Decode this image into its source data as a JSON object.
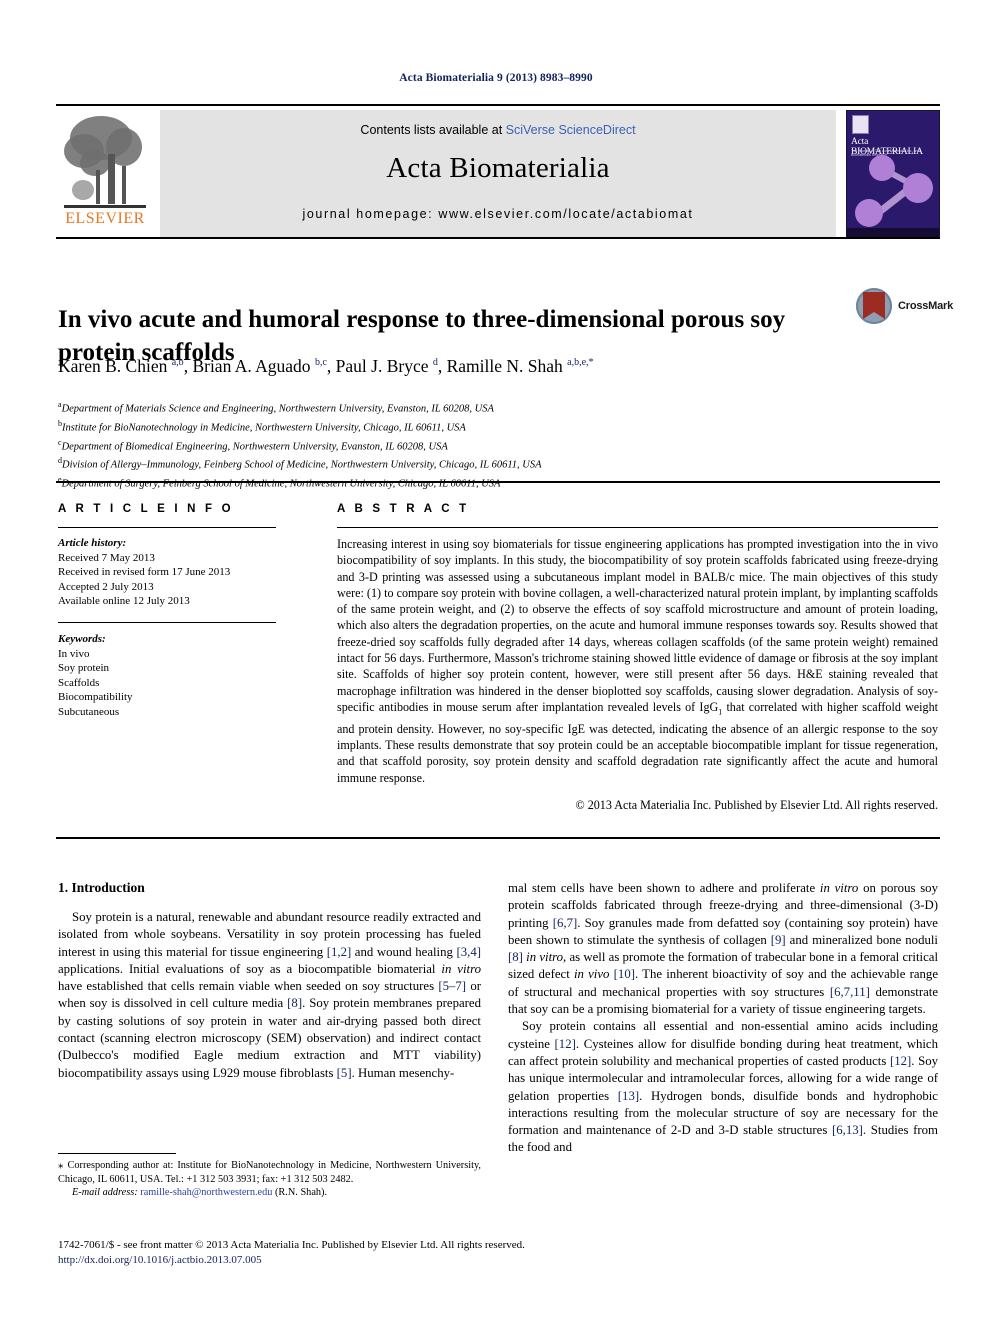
{
  "running_head": "Acta Biomaterialia 9 (2013) 8983–8990",
  "masthead": {
    "contents_prefix": "Contents lists available at ",
    "contents_link": "SciVerse ScienceDirect",
    "journal_name": "Acta Biomaterialia",
    "homepage": "journal homepage: www.elsevier.com/locate/actabiomat",
    "publisher_logo_text": "ELSEVIER",
    "cover_title": "Acta BIOMATERIALIA",
    "cover_subtitle": "The Journal of The Acta Materialia Inc. and Biomaterials Research"
  },
  "article": {
    "title": "In vivo acute and humoral response to three-dimensional porous soy protein scaffolds",
    "crossmark_label": "CrossMark",
    "authors_html": "Karen B. Chien <sup>a,b</sup>, Brian A. Aguado <sup>b,c</sup>, Paul J. Bryce <sup>d</sup>, Ramille N. Shah <sup>a,b,e,</sup><sup>*</sup>",
    "affiliations": [
      {
        "mark": "a",
        "text": "Department of Materials Science and Engineering, Northwestern University, Evanston, IL 60208, USA"
      },
      {
        "mark": "b",
        "text": "Institute for BioNanotechnology in Medicine, Northwestern University, Chicago, IL 60611, USA"
      },
      {
        "mark": "c",
        "text": "Department of Biomedical Engineering, Northwestern University, Evanston, IL 60208, USA"
      },
      {
        "mark": "d",
        "text": "Division of Allergy–Immunology, Feinberg School of Medicine, Northwestern University, Chicago, IL 60611, USA"
      },
      {
        "mark": "e",
        "text": "Department of Surgery, Feinberg School of Medicine, Northwestern University, Chicago, IL 60611, USA"
      }
    ]
  },
  "article_info": {
    "heading": "A R T I C L E   I N F O",
    "history_label": "Article history:",
    "history": [
      "Received 7 May 2013",
      "Received in revised form 17 June 2013",
      "Accepted 2 July 2013",
      "Available online 12 July 2013"
    ],
    "keywords_label": "Keywords:",
    "keywords": [
      "In vivo",
      "Soy protein",
      "Scaffolds",
      "Biocompatibility",
      "Subcutaneous"
    ]
  },
  "abstract": {
    "heading": "A B S T R A C T",
    "text_html": "Increasing interest in using soy biomaterials for tissue engineering applications has prompted investigation into the in vivo biocompatibility of soy implants. In this study, the biocompatibility of soy protein scaffolds fabricated using freeze-drying and 3-D printing was assessed using a subcutaneous implant model in BALB/c mice. The main objectives of this study were: (1) to compare soy protein with bovine collagen, a well-characterized natural protein implant, by implanting scaffolds of the same protein weight, and (2) to observe the effects of soy scaffold microstructure and amount of protein loading, which also alters the degradation properties, on the acute and humoral immune responses towards soy. Results showed that freeze-dried soy scaffolds fully degraded after 14 days, whereas collagen scaffolds (of the same protein weight) remained intact for 56 days. Furthermore, Masson's trichrome staining showed little evidence of damage or fibrosis at the soy implant site. Scaffolds of higher soy protein content, however, were still present after 56 days. H&amp;E staining revealed that macrophage infiltration was hindered in the denser bioplotted soy scaffolds, causing slower degradation. Analysis of soy-specific antibodies in mouse serum after implantation revealed levels of IgG<sub>1</sub> that correlated with higher scaffold weight and protein density. However, no soy-specific IgE was detected, indicating the absence of an allergic response to the soy implants. These results demonstrate that soy protein could be an acceptable biocompatible implant for tissue regeneration, and that scaffold porosity, soy protein density and scaffold degradation rate significantly affect the acute and humoral immune response.",
    "copyright": "© 2013 Acta Materialia Inc. Published by Elsevier Ltd. All rights reserved."
  },
  "body": {
    "section_heading": "1. Introduction",
    "left_paragraphs_html": [
      "Soy protein is a natural, renewable and abundant resource readily extracted and isolated from whole soybeans. Versatility in soy protein processing has fueled interest in using this material for tissue engineering <span class=\"ref\">[1,2]</span> and wound healing <span class=\"ref\">[3,4]</span> applications. Initial evaluations of soy as a biocompatible biomaterial <span class=\"it\">in vitro</span> have established that cells remain viable when seeded on soy structures <span class=\"ref\">[5–7]</span> or when soy is dissolved in cell culture media <span class=\"ref\">[8]</span>. Soy protein membranes prepared by casting solutions of soy protein in water and air-drying passed both direct contact (scanning electron microscopy (SEM) observation) and indirect contact (Dulbecco's modified Eagle medium extraction and MTT viability) biocompatibility assays using L929 mouse fibroblasts <span class=\"ref\">[5]</span>. Human mesenchy-"
    ],
    "right_paragraphs_html": [
      "mal stem cells have been shown to adhere and proliferate <span class=\"it\">in vitro</span> on porous soy protein scaffolds fabricated through freeze-drying and three-dimensional (3-D) printing <span class=\"ref\">[6,7]</span>. Soy granules made from defatted soy (containing soy protein) have been shown to stimulate the synthesis of collagen <span class=\"ref\">[9]</span> and mineralized bone noduli <span class=\"ref\">[8]</span> <span class=\"it\">in vitro</span>, as well as promote the formation of trabecular bone in a femoral critical sized defect <span class=\"it\">in vivo</span> <span class=\"ref\">[10]</span>. The inherent bioactivity of soy and the achievable range of structural and mechanical properties with soy structures <span class=\"ref\">[6,7,11]</span> demonstrate that soy can be a promising biomaterial for a variety of tissue engineering targets.",
      "Soy protein contains all essential and non-essential amino acids including cysteine <span class=\"ref\">[12]</span>. Cysteines allow for disulfide bonding during heat treatment, which can affect protein solubility and mechanical properties of casted products <span class=\"ref\">[12]</span>. Soy has unique intermolecular and intramolecular forces, allowing for a wide range of gelation properties <span class=\"ref\">[13]</span>. Hydrogen bonds, disulfide bonds and hydrophobic interactions resulting from the molecular structure of soy are necessary for the formation and maintenance of 2-D and 3-D stable structures <span class=\"ref\">[6,13]</span>. Studies from the food and"
    ]
  },
  "footnote": {
    "corresponding_html": "<span class=\"star\">⁎</span> Corresponding author at: Institute for BioNanotechnology in Medicine, Northwestern University, Chicago, IL 60611, USA. Tel.: +1 312 503 3931; fax: +1 312 503 2482.",
    "email_label": "E-mail address:",
    "email": "ramille-shah@northwestern.edu",
    "email_suffix": "(R.N. Shah)."
  },
  "frontmatter": {
    "line": "1742-7061/$ - see front matter © 2013 Acta Materialia Inc. Published by Elsevier Ltd. All rights reserved.",
    "doi": "http://dx.doi.org/10.1016/j.actbio.2013.07.005"
  }
}
